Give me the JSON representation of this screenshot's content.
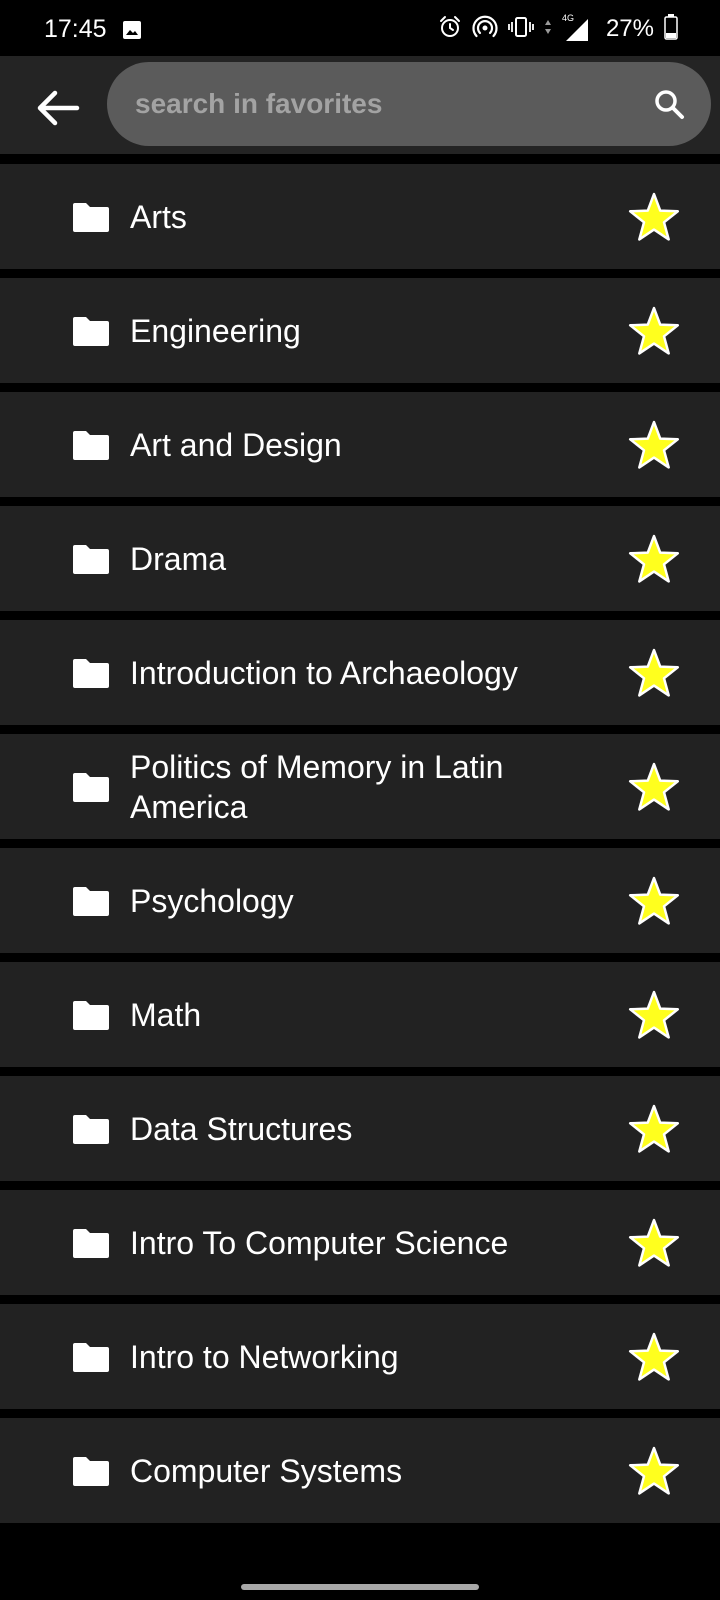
{
  "status_bar": {
    "time": "17:45",
    "network_label": "4G",
    "battery_percent": "27%",
    "battery_level": 0.27,
    "icons": [
      "image-icon",
      "alarm-icon",
      "hotspot-icon",
      "vibrate-icon",
      "data-arrows-icon",
      "signal-icon",
      "battery-icon"
    ]
  },
  "app_bar": {
    "back_icon": "arrow-left-icon",
    "search": {
      "placeholder": "search in favorites",
      "value": "",
      "icon": "search-icon"
    }
  },
  "favorites": {
    "items": [
      {
        "label": "Arts",
        "starred": true
      },
      {
        "label": "Engineering",
        "starred": true
      },
      {
        "label": "Art and Design",
        "starred": true
      },
      {
        "label": "Drama",
        "starred": true
      },
      {
        "label": "Introduction to Archaeology",
        "starred": true
      },
      {
        "label": "Politics of Memory in Latin America",
        "starred": true
      },
      {
        "label": "Psychology",
        "starred": true
      },
      {
        "label": "Math",
        "starred": true
      },
      {
        "label": "Data Structures",
        "starred": true
      },
      {
        "label": "Intro To Computer Science",
        "starred": true
      },
      {
        "label": "Intro to Networking",
        "starred": true
      },
      {
        "label": "Computer Systems",
        "starred": true
      }
    ]
  },
  "colors": {
    "background": "#000000",
    "app_bar": "#242424",
    "search_box": "#5b5b5b",
    "placeholder": "#a3a3a3",
    "list_item": "#222222",
    "star_fill": "#ffff1e",
    "star_outline": "#ffffff",
    "text": "#ffffff"
  }
}
